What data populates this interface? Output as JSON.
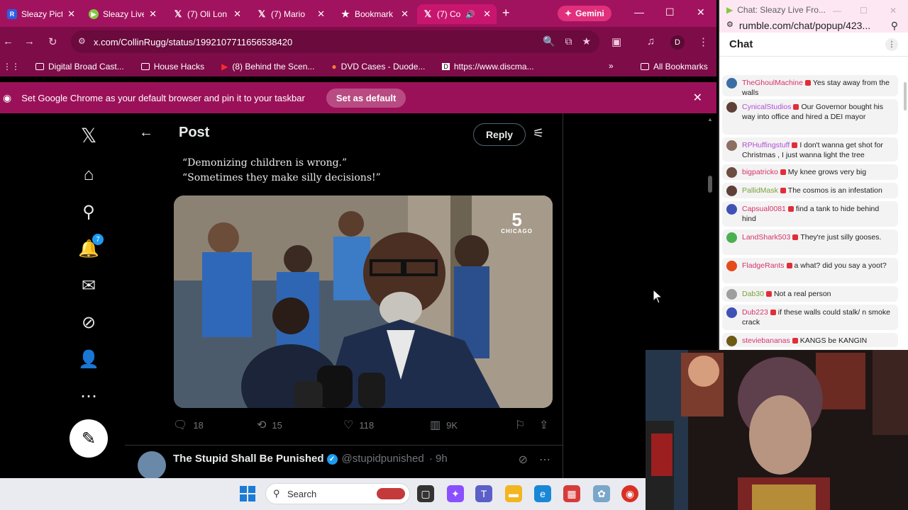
{
  "browser": {
    "tabs": [
      {
        "title": "Sleazy Pict",
        "favicon": "rumble-r-icon"
      },
      {
        "title": "Sleazy Live",
        "favicon": "rumble-play-icon"
      },
      {
        "title": "(7) Oli Lon",
        "favicon": "x-icon"
      },
      {
        "title": "(7) Mario",
        "favicon": "x-icon"
      },
      {
        "title": "Bookmark",
        "favicon": "star-icon"
      },
      {
        "title": "(7) Co",
        "favicon": "x-icon"
      }
    ],
    "gemini_label": "Gemini",
    "url": "x.com/CollinRugg/status/1992107711656538420",
    "profile_initial": "D",
    "bookmarks": [
      "Digital Broad Cast...",
      "House Hacks",
      "(8) Behind the Scen...",
      "DVD Cases - Duode...",
      "https://www.discma..."
    ],
    "all_bookmarks": "All Bookmarks",
    "infobar_text": "Set Google Chrome as your default browser and pin it to your taskbar",
    "set_default_label": "Set as default"
  },
  "x": {
    "notification_count": "7",
    "header_title": "Post",
    "reply_label": "Reply",
    "quote_line1": "“Demonizing children is wrong.”",
    "quote_line2": "“Sometimes they make silly decisions!”",
    "media_logo_number": "5",
    "media_logo_city": "CHICAGO",
    "stats": {
      "replies": "18",
      "reposts": "15",
      "likes": "118",
      "views": "9K"
    },
    "next_post": {
      "name": "The Stupid Shall Be Punished",
      "handle": "@stupidpunished",
      "time": "· 9h"
    }
  },
  "chat": {
    "window_title": "Chat: Sleazy Live Fro...",
    "url": "rumble.com/chat/popup/423...",
    "header": "Chat",
    "messages": [
      {
        "user": "TheGhoulMachine",
        "text": "Yes stay away from the walls",
        "user_color": "#d6336c"
      },
      {
        "user": "CynicalStudios",
        "text": "Our Governor bought his way into office and hired a DEI mayor",
        "user_color": "#b24fd6"
      },
      {
        "user": "RPHuffingstuff",
        "text": "I don't wanna get shot for Christmas , I just wanna light the tree",
        "user_color": "#b24fd6"
      },
      {
        "user": "bigpatricko",
        "text": "My knee grows very big",
        "user_color": "#d6336c"
      },
      {
        "user": "PallidMask",
        "text": "The cosmos is an infestation",
        "user_color": "#7aa33b"
      },
      {
        "user": "Capsual0081",
        "text": "find a tank to hide behind hind",
        "user_color": "#d6336c"
      },
      {
        "user": "LandShark503",
        "text": "They're just silly gooses.",
        "user_color": "#d6336c"
      },
      {
        "user": "FladgeRants",
        "text": "a what? did you say a yoot?",
        "user_color": "#d6336c"
      },
      {
        "user": "Dab30",
        "text": "Not a real person",
        "user_color": "#7aa33b"
      },
      {
        "user": "Dub223",
        "text": "if these walls could stalk/ n smoke crack",
        "user_color": "#d6336c"
      },
      {
        "user": "steviebananas",
        "text": "KANGS be KANGIN",
        "user_color": "#d6336c"
      }
    ]
  },
  "taskbar": {
    "search_label": "Search"
  }
}
